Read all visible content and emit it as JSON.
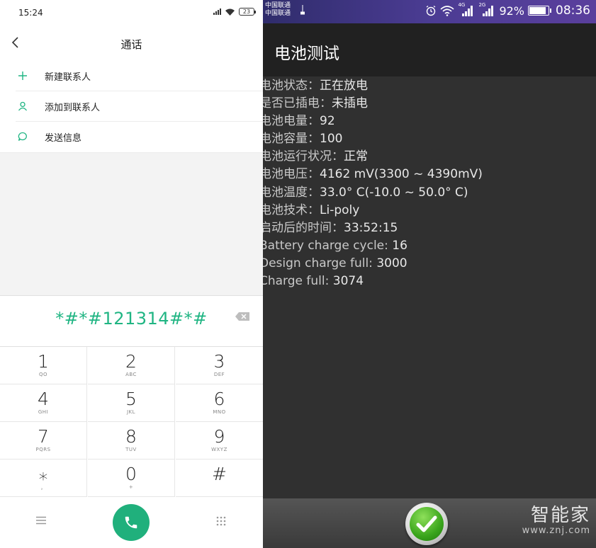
{
  "left_phone": {
    "status_bar": {
      "time": "15:24",
      "battery": "23"
    },
    "header": {
      "title": "通话"
    },
    "menu_items": [
      {
        "label": "新建联系人",
        "icon": "plus-icon"
      },
      {
        "label": "添加到联系人",
        "icon": "person-icon"
      },
      {
        "label": "发送信息",
        "icon": "message-bubble-icon"
      }
    ],
    "dialed_number": "*#*#121314#*#",
    "keypad": [
      {
        "num": "1",
        "sub": "QO"
      },
      {
        "num": "2",
        "sub": "ABC"
      },
      {
        "num": "3",
        "sub": "DEF"
      },
      {
        "num": "4",
        "sub": "GHI"
      },
      {
        "num": "5",
        "sub": "JKL"
      },
      {
        "num": "6",
        "sub": "MNO"
      },
      {
        "num": "7",
        "sub": "PQRS"
      },
      {
        "num": "8",
        "sub": "TUV"
      },
      {
        "num": "9",
        "sub": "WXYZ"
      },
      {
        "num": "⁎",
        "sub": "，"
      },
      {
        "num": "0",
        "sub": "+"
      },
      {
        "num": "#",
        "sub": ""
      }
    ],
    "accent_color": "#20b583"
  },
  "right_phone": {
    "status_bar": {
      "carrier_1": "中国联通",
      "carrier_2": "中国联通",
      "net_1": "4G",
      "net_2": "2G",
      "battery_pct": "92%",
      "battery_level": 0.92,
      "time": "08:36"
    },
    "app_title": "电池测试",
    "rows": [
      {
        "label": "电池状态：",
        "value": "正在放电"
      },
      {
        "label": "是否已插电：",
        "value": "未插电"
      },
      {
        "label": "电池电量：",
        "value": "92"
      },
      {
        "label": "电池容量：",
        "value": "100"
      },
      {
        "label": "电池运行状况：",
        "value": "正常"
      },
      {
        "label": "电池电压：",
        "value": "4162 mV(3300 ~ 4390mV)"
      },
      {
        "label": "电池温度：",
        "value": "33.0° C(-10.0 ~ 50.0° C)"
      },
      {
        "label": "电池技术：",
        "value": "Li-poly"
      },
      {
        "label": "启动后的时间：",
        "value": "33:52:15"
      },
      {
        "label": "Battery charge cycle: ",
        "value": "16"
      },
      {
        "label": "Design charge full: ",
        "value": "3000"
      },
      {
        "label": "Charge full: ",
        "value": "3074"
      }
    ],
    "watermark": {
      "logo": "智能家",
      "url": "www.znj.com"
    }
  }
}
